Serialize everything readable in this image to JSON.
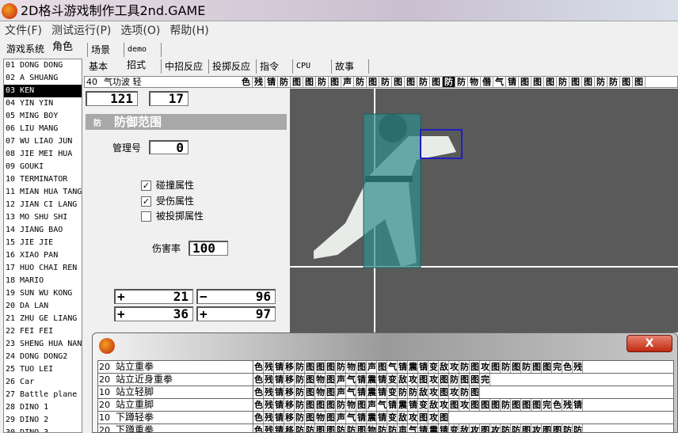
{
  "window": {
    "title": "2D格斗游戏制作工具2nd.GAME"
  },
  "menu": [
    "文件(F)",
    "测试运行(P)",
    "选项(O)",
    "帮助(H)"
  ],
  "top_tabs": [
    "游戏系统",
    "角色",
    "场景",
    "demo"
  ],
  "characters": [
    "01 DONG DONG",
    "02 A SHUANG",
    "03 KEN",
    "04 YIN YIN",
    "05 MING BOY",
    "06 LIU MANG",
    "07 WU LIAO JUN",
    "08 JIE MEI HUA",
    "09 GOUKI",
    "10 TERMINATOR",
    "11 MIAN HUA TANG",
    "12 JIAN CI LANG",
    "13 MO SHU SHI",
    "14 JIANG BAO",
    "15 JIE JIE",
    "16 XIAO PAN",
    "17 HUO CHAI REN",
    "18 MARIO",
    "19 SUN WU KONG",
    "20 DA LAN",
    "21 ZHU GE LIANG",
    "22 FEI FEI",
    "23 SHENG HUA NAN",
    "24 DONG DONG2",
    "25 TUO LEI",
    "26 Car",
    "27 Battle plane",
    "28 DINO 1",
    "29 DINO 2",
    "30 DINO 3"
  ],
  "selected_character": "03 KEN",
  "char_tabs": [
    "基本",
    "招式",
    "中招反应",
    "投掷反应",
    "指令",
    "CPU",
    "故事"
  ],
  "move": {
    "num": "40",
    "name": "气功波 轻",
    "cells": "色残锖防图图防图声防图防图图防图防防物僭气锖图图图防图图防防图图",
    "selected_cell": 16
  },
  "frame": {
    "a": "121",
    "b": "17"
  },
  "section": {
    "icon": "防",
    "title": "防御范围"
  },
  "manage": {
    "label": "管理号",
    "value": "0"
  },
  "checks": [
    {
      "label": "碰撞属性",
      "checked": true
    },
    {
      "label": "受伤属性",
      "checked": true
    },
    {
      "label": "被投掷属性",
      "checked": false
    }
  ],
  "damage": {
    "label": "伤害率",
    "value": "100"
  },
  "coords": [
    {
      "sign": "+",
      "value": "21"
    },
    {
      "sign": "−",
      "value": "96"
    },
    {
      "sign": "+",
      "value": "36"
    },
    {
      "sign": "+",
      "value": "97"
    }
  ],
  "dialog": {
    "close": "X",
    "rows": [
      {
        "n": "20",
        "name": "站立重拳",
        "cells": "色残锖移防图图图防物图声图气锖震锖变敌攻防图攻图防图防图图完色残"
      },
      {
        "n": "20",
        "name": "站立近身重拳",
        "cells": "色残锖移防图物图声气锖震锖变敌攻图攻图防图图完"
      },
      {
        "n": "10",
        "name": "站立轻脚",
        "cells": "色残锖移防图物图声气锖震锖变防防敌攻图攻防图"
      },
      {
        "n": "20",
        "name": "站立重脚",
        "cells": "色残锖移防图图图防物图声气锖震锖变敌攻图攻图图图防图图图完色残锖"
      },
      {
        "n": "10",
        "name": "下蹲轻拳",
        "cells": "色残锖移防图物图声气锖震锖变敌攻图攻图"
      },
      {
        "n": "20",
        "name": "下蹲重拳",
        "cells": "色残锖移防防图图防防图物防防声气锖震锖变敌攻图攻防防图攻图图防防"
      }
    ]
  },
  "colors": {
    "hitbox": "#2f8c8c",
    "attackbox": "#2020c0",
    "canvas": "#5a5a5a"
  }
}
